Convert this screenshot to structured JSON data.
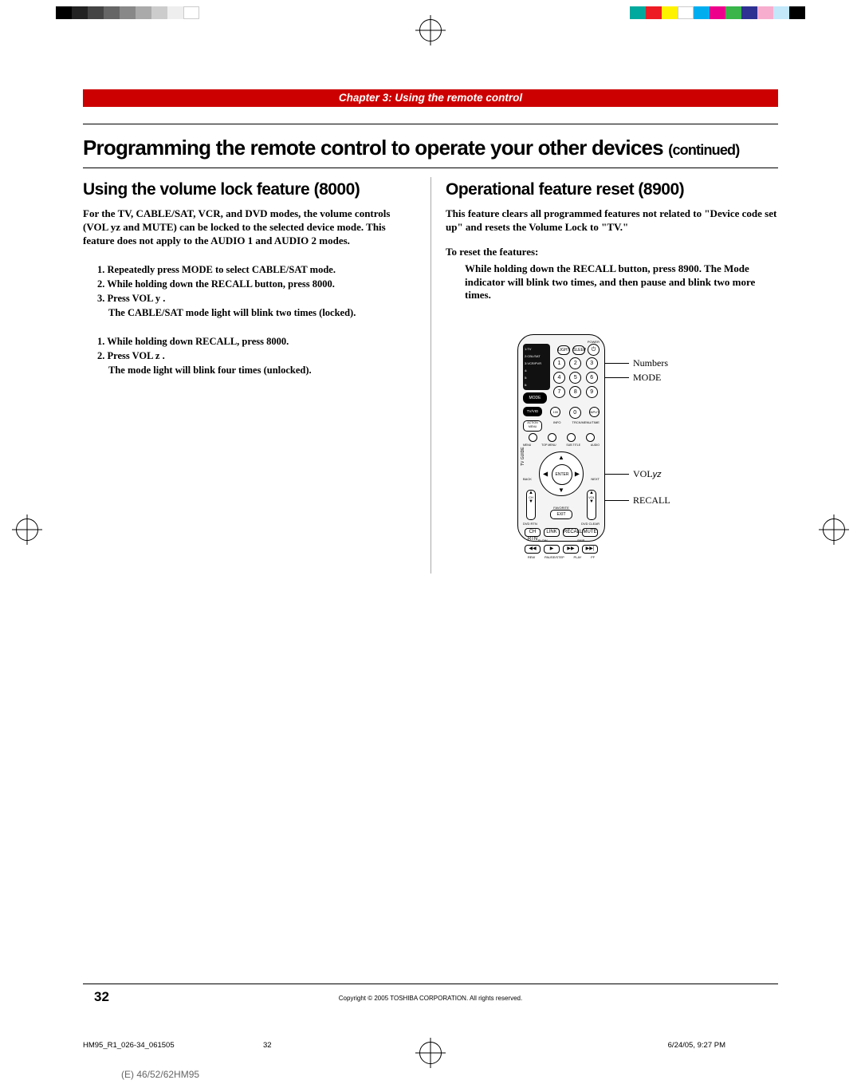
{
  "chapter_bar": "Chapter 3: Using the remote control",
  "main_title": "Programming the remote control to operate your other devices",
  "main_title_cont": "(continued)",
  "left": {
    "heading": "Using the volume lock feature (8000)",
    "intro": "For the TV, CABLE/SAT, VCR, and DVD modes, the volume controls (VOL yz and MUTE) can be locked to the selected device mode. This feature does not apply to the AUDIO 1 and AUDIO 2 modes.",
    "lock_steps": {
      "s1": "1. Repeatedly press MODE to select CABLE/SAT mode.",
      "s2": "2. While holding down the RECALL button, press 8000.",
      "s3": "3. Press VOL y .",
      "s3_result": "The CABLE/SAT mode light will blink two times (locked)."
    },
    "unlock_steps": {
      "s1": "1. While holding down RECALL, press 8000.",
      "s2": "2. Press VOL z .",
      "s2_result": "The mode light will blink four times (unlocked)."
    }
  },
  "right": {
    "heading": "Operational feature reset (8900)",
    "intro": "This feature clears all programmed features not related to \"Device code set up\" and resets the Volume Lock to \"TV.\"",
    "toreset": "To reset the features:",
    "step": "While holding down the RECALL button, press 8900. The Mode indicator will blink two times, and then pause and blink two more times.",
    "remote_labels": {
      "numbers": "Numbers",
      "mode": "MODE",
      "volyz": "VOLyz",
      "recall": "RECALL"
    },
    "remote": {
      "power": "POWER",
      "hub": [
        "1:TV",
        "2:CBL/SAT",
        "3:VCR/PVR",
        "4:",
        "5:",
        "6:"
      ],
      "topsmall": [
        "LIGHT",
        "SLEEP"
      ],
      "mode": "MODE",
      "tv_vid": "TV/VID",
      "mid": [
        "100",
        "0",
        "INPUT"
      ],
      "action_menu": "ACTION MENU",
      "labels_row": [
        "INFO",
        "TRCK/MENU/TIME"
      ],
      "menu_row": [
        "MENU",
        "TOP MENU",
        "SUB TITLE",
        "AUDIO"
      ],
      "guide": "TV GUIDE",
      "enter": "ENTER",
      "back": "BACK",
      "next": "NEXT",
      "ch": "CH",
      "vol": "VOL",
      "favorite": "FAVORITE",
      "exit": "EXIT",
      "dvdrtn": "DVD RTN",
      "dvdclear": "DVD CLEAR",
      "bottom_row": [
        "CH RTN",
        "LINK",
        "RECALL",
        "MUTE"
      ],
      "transport": [
        "◀◀",
        "▶",
        "▶▶",
        "▶▶|"
      ],
      "transport2": [
        "REW",
        "PAUSE/STEP",
        "PLAY",
        "FF"
      ],
      "slow": "SLOW",
      "skip": "SKIP"
    }
  },
  "footer": {
    "page_num": "32",
    "copyright": "Copyright © 2005 TOSHIBA CORPORATION. All rights reserved.",
    "file": "HM95_R1_026-34_061505",
    "page_sub": "32",
    "date": "6/24/05, 9:27 PM",
    "cut": "(E) 46/52/62HM95"
  }
}
